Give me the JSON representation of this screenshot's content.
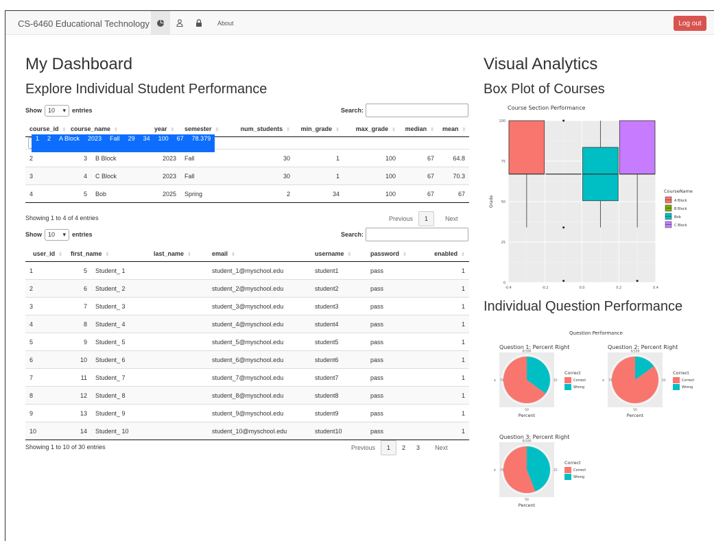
{
  "navbar": {
    "brand": "CS-6460 Educational Technology",
    "icons": [
      "pie-chart-icon",
      "user-icon",
      "lock-icon"
    ],
    "about": "About",
    "logout": "Log out"
  },
  "left": {
    "title": "My Dashboard",
    "subtitle": "Explore Individual Student Performance"
  },
  "courses_table": {
    "show_label": "Show",
    "entries_value": "10",
    "entries_label": "entries",
    "search_label": "Search:",
    "columns": [
      "",
      "course_id",
      "course_name",
      "year",
      "semester",
      "num_students",
      "min_grade",
      "max_grade",
      "median",
      "mean"
    ],
    "rows": [
      [
        "1",
        "2",
        "A Block",
        "2023",
        "Fall",
        "29",
        "34",
        "100",
        "67",
        "78.379"
      ],
      [
        "2",
        "3",
        "B Block",
        "2023",
        "Fall",
        "30",
        "1",
        "100",
        "67",
        "64.8"
      ],
      [
        "3",
        "4",
        "C Block",
        "2023",
        "Fall",
        "30",
        "1",
        "100",
        "67",
        "70.3"
      ],
      [
        "4",
        "5",
        "Bob",
        "2025",
        "Spring",
        "2",
        "34",
        "100",
        "67",
        "67"
      ]
    ],
    "info": "Showing 1 to 4 of 4 entries",
    "pagination": {
      "previous": "Previous",
      "pages": [
        "1"
      ],
      "next": "Next"
    }
  },
  "users_table": {
    "show_label": "Show",
    "entries_value": "10",
    "entries_label": "entries",
    "search_label": "Search:",
    "columns": [
      "",
      "user_id",
      "first_name",
      "last_name",
      "email",
      "username",
      "password",
      "enabled"
    ],
    "rows": [
      [
        "1",
        "5",
        "Student_ 1",
        "",
        "student_1@myschool.edu",
        "student1",
        "pass",
        "1"
      ],
      [
        "2",
        "6",
        "Student_ 2",
        "",
        "student_2@myschool.edu",
        "student2",
        "pass",
        "1"
      ],
      [
        "3",
        "7",
        "Student_ 3",
        "",
        "student_3@myschool.edu",
        "student3",
        "pass",
        "1"
      ],
      [
        "4",
        "8",
        "Student_ 4",
        "",
        "student_4@myschool.edu",
        "student4",
        "pass",
        "1"
      ],
      [
        "5",
        "9",
        "Student_ 5",
        "",
        "student_5@myschool.edu",
        "student5",
        "pass",
        "1"
      ],
      [
        "6",
        "10",
        "Student_ 6",
        "",
        "student_6@myschool.edu",
        "student6",
        "pass",
        "1"
      ],
      [
        "7",
        "11",
        "Student_ 7",
        "",
        "student_7@myschool.edu",
        "student7",
        "pass",
        "1"
      ],
      [
        "8",
        "12",
        "Student_ 8",
        "",
        "student_8@myschool.edu",
        "student8",
        "pass",
        "1"
      ],
      [
        "9",
        "13",
        "Student_ 9",
        "",
        "student_9@myschool.edu",
        "student9",
        "pass",
        "1"
      ],
      [
        "10",
        "14",
        "Student_ 10",
        "",
        "student_10@myschool.edu",
        "student10",
        "pass",
        "1"
      ]
    ],
    "info": "Showing 1 to 10 of 30 entries",
    "pagination": {
      "previous": "Previous",
      "pages": [
        "1",
        "2",
        "3"
      ],
      "next": "Next"
    }
  },
  "right": {
    "title": "Visual Analytics",
    "boxplot_heading": "Box Plot of Courses",
    "question_heading": "Individual Question Performance"
  },
  "colors": {
    "a_block": "#f8766d",
    "b_block": "#7cae00",
    "bob": "#00bfc4",
    "c_block": "#c77cff",
    "correct": "#f8766d",
    "wrong": "#00bfc4",
    "selected_row": "#0d6efd",
    "logout": "#d9534f"
  },
  "chart_data": [
    {
      "type": "box",
      "title": "Course Section Performance",
      "ylabel": "Grade",
      "xlabel": "",
      "xlim": [
        -0.4,
        0.4
      ],
      "ylim": [
        0,
        100
      ],
      "x_ticks": [
        "-0.4",
        "-0.2",
        "0.0",
        "0.2",
        "0.4"
      ],
      "y_ticks": [
        "0",
        "25",
        "50",
        "75",
        "100"
      ],
      "legend_title": "CourseName",
      "legend_position": "right",
      "series": [
        {
          "name": "A Block",
          "x_range": [
            -0.4,
            -0.2
          ],
          "whisker_low": 34,
          "q1": 67,
          "median": 67,
          "q3": 100,
          "whisker_high": 100,
          "outliers": []
        },
        {
          "name": "B Block",
          "x_range": [
            -0.2,
            0.0
          ],
          "whisker_low": 67,
          "q1": 67,
          "median": 67,
          "q3": 67,
          "whisker_high": 67,
          "outliers": [
            1,
            34,
            100
          ]
        },
        {
          "name": "Bob",
          "x_range": [
            0.0,
            0.2
          ],
          "whisker_low": 34,
          "q1": 50.5,
          "median": 67,
          "q3": 83.5,
          "whisker_high": 100,
          "outliers": []
        },
        {
          "name": "C Block",
          "x_range": [
            0.2,
            0.4
          ],
          "whisker_low": 34,
          "q1": 67,
          "median": 67,
          "q3": 100,
          "whisker_high": 100,
          "outliers": [
            1
          ]
        }
      ]
    },
    {
      "type": "pie",
      "group_title": "Question Performance",
      "legend_title": "Correct",
      "xlabel": "Percent",
      "ticks": [
        "0/100",
        "25",
        "50",
        "75"
      ],
      "charts": [
        {
          "title": "Question 1: Percent Right",
          "slices": [
            {
              "label": "Correct",
              "value": 65
            },
            {
              "label": "Wrong",
              "value": 35
            }
          ]
        },
        {
          "title": "Question 2: Percent Right",
          "slices": [
            {
              "label": "Correct",
              "value": 85
            },
            {
              "label": "Wrong",
              "value": 15
            }
          ]
        },
        {
          "title": "Question 3: Percent Right",
          "slices": [
            {
              "label": "Correct",
              "value": 56
            },
            {
              "label": "Wrong",
              "value": 44
            }
          ]
        }
      ]
    }
  ]
}
